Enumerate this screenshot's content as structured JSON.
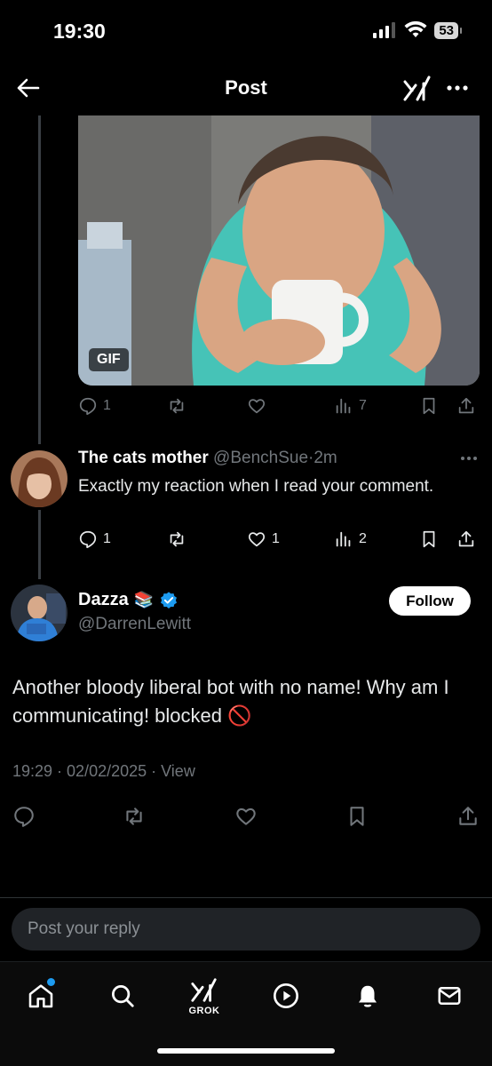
{
  "status_bar": {
    "time": "19:30",
    "battery": "53"
  },
  "header": {
    "title": "Post"
  },
  "gif_tweet": {
    "badge": "GIF",
    "reply_count": "1",
    "views": "7"
  },
  "reply": {
    "name": "The cats mother",
    "handle": "@BenchSue",
    "separator": "·",
    "time": "2m",
    "text": "Exactly my reaction when I read your comment.",
    "reply_count": "1",
    "like_count": "1",
    "views": "2"
  },
  "main_post": {
    "name": "Dazza",
    "name_emoji": "📚",
    "handle": "@DarrenLewitt",
    "follow_label": "Follow",
    "text": "Another bloody liberal bot with no name! Why am I communicating! blocked 🚫",
    "timestamp": "19:29 · 02/02/2025 · ",
    "view_label": "View"
  },
  "reply_box": {
    "placeholder": "Post your reply"
  },
  "bottom_nav": {
    "grok_label": "GROK"
  },
  "colors": {
    "background": "#000000",
    "muted": "#71767b",
    "accent": "#1d9bf0",
    "verified": "#1d9bf0"
  }
}
